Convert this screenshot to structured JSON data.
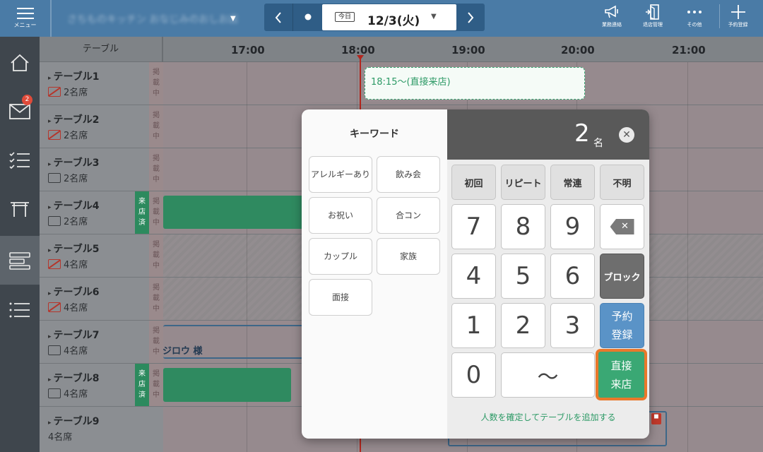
{
  "topbar": {
    "menu_label": "メニュー",
    "store_name": "さちものキッチン おなじみのおしお店",
    "today_label": "今日",
    "date": "12/3(火)",
    "actions": [
      {
        "label": "業務連絡",
        "icon": "megaphone-icon"
      },
      {
        "label": "退店管理",
        "icon": "exit-door-icon"
      },
      {
        "label": "その他",
        "icon": "more-dots-icon"
      },
      {
        "label": "予約登録",
        "icon": "plus-icon"
      }
    ]
  },
  "sidebar": {
    "items": [
      {
        "name": "home",
        "icon": "home-icon"
      },
      {
        "name": "messages",
        "icon": "mail-icon",
        "badge": "2"
      },
      {
        "name": "checklist",
        "icon": "checklist-icon"
      },
      {
        "name": "tables",
        "icon": "table-icon"
      },
      {
        "name": "timeline",
        "icon": "timeline-icon",
        "active": true
      },
      {
        "name": "list",
        "icon": "list-icon"
      }
    ]
  },
  "grid": {
    "table_header": "テーブル",
    "times": [
      "17:00",
      "18:00",
      "19:00",
      "20:00",
      "21:00"
    ],
    "status_text": "掲載中",
    "arrived_text": "来店済",
    "rows": [
      {
        "name": "テーブル1",
        "seats": "2名席",
        "ng": true
      },
      {
        "name": "テーブル2",
        "seats": "2名席",
        "ng": true
      },
      {
        "name": "テーブル3",
        "seats": "2名席",
        "ng": false
      },
      {
        "name": "テーブル4",
        "seats": "2名席",
        "ng": false,
        "arrived": true
      },
      {
        "name": "テーブル5",
        "seats": "4名席",
        "ng": true
      },
      {
        "name": "テーブル6",
        "seats": "4名席",
        "ng": true
      },
      {
        "name": "テーブル7",
        "seats": "4名席",
        "ng": false
      },
      {
        "name": "テーブル8",
        "seats": "4名席",
        "ng": false,
        "arrived": true
      },
      {
        "name": "テーブル9",
        "seats": "4名席",
        "ng": false
      }
    ],
    "new_reservation": "18:15～(直接来店)",
    "reservation_guest": "ジロウ 様"
  },
  "popup": {
    "keyword_title": "キーワード",
    "keywords": [
      "アレルギーあり",
      "飲み会",
      "お祝い",
      "合コン",
      "カップル",
      "家族",
      "面接"
    ],
    "party_size": "2",
    "party_unit": "名",
    "categories": [
      "初回",
      "リピート",
      "常連",
      "不明"
    ],
    "digits": [
      "7",
      "8",
      "9",
      "4",
      "5",
      "6",
      "1",
      "2",
      "3",
      "0"
    ],
    "tilde": "～",
    "block_label": "ブロック",
    "reserve_label_1": "予約",
    "reserve_label_2": "登録",
    "walkin_label_1": "直接",
    "walkin_label_2": "来店",
    "footer_link": "人数を確定してテーブルを追加する"
  },
  "colors": {
    "topbar": "#4a7ba6",
    "accent_green": "#3aa874",
    "highlight_orange": "#e9782b",
    "reserve_blue": "#5a93c7",
    "now_line": "#b3261e"
  }
}
